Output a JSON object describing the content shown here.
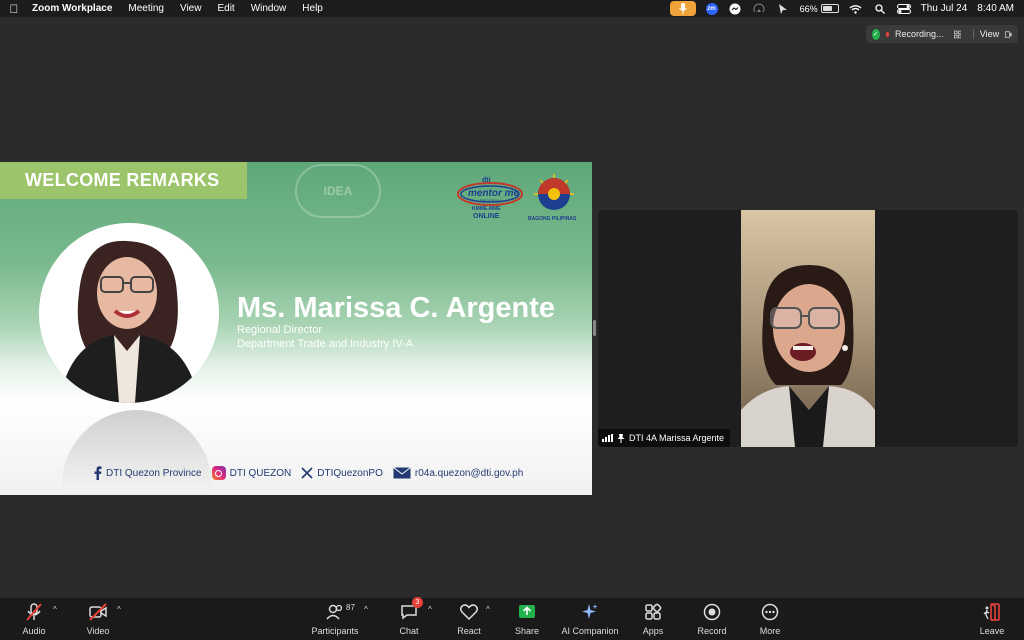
{
  "menubar": {
    "app_name": "Zoom Workplace",
    "items": [
      "Meeting",
      "View",
      "Edit",
      "Window",
      "Help"
    ],
    "battery": "66%",
    "date": "Thu Jul 24",
    "time": "8:40 AM",
    "zoom_badge": "zm"
  },
  "recording": {
    "label": "Recording...",
    "view_label": "View"
  },
  "slide": {
    "banner": "WELCOME REMARKS",
    "watermark": "IDEA",
    "speaker_name": "Ms. Marissa C. Argente",
    "speaker_role": "Regional Director",
    "speaker_dept": "Department Trade and Industry IV-A",
    "logos": {
      "mentor_dti": "dti",
      "mentor_title": "mentor me",
      "mentor_program": "PROGRAM",
      "mentor_sub": "KMME-MME",
      "mentor_online": "ONLINE",
      "bagong": "BAGONG PILIPINAS"
    },
    "social": {
      "facebook": "DTI Quezon Province",
      "instagram": "DTI QUEZON",
      "x": "DTIQuezonPO",
      "email": "r04a.quezon@dti.gov.ph"
    }
  },
  "participant": {
    "name": "DTI 4A Marissa Argente"
  },
  "toolbar": {
    "audio": "Audio",
    "video": "Video",
    "participants": "Participants",
    "participants_count": "87",
    "chat": "Chat",
    "chat_badge": "3",
    "react": "React",
    "share": "Share",
    "ai": "AI Companion",
    "apps": "Apps",
    "record": "Record",
    "more": "More",
    "leave": "Leave"
  },
  "colors": {
    "share_green": "#23b14d",
    "leave_red": "#e8413a",
    "mic_orange": "#f0a33a",
    "banner_green": "#9cc46a"
  }
}
